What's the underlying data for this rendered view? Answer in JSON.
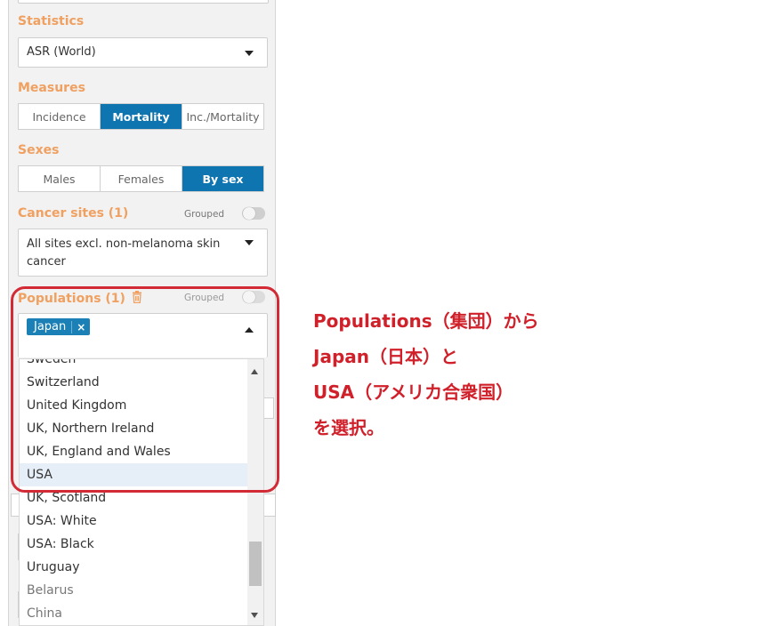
{
  "statistics": {
    "label": "Statistics",
    "value": "ASR (World)"
  },
  "measures": {
    "label": "Measures",
    "options": [
      "Incidence",
      "Mortality",
      "Inc./Mortality"
    ],
    "active": "Mortality"
  },
  "sexes": {
    "label": "Sexes",
    "options": [
      "Males",
      "Females",
      "By sex"
    ],
    "active": "By sex"
  },
  "cancer_sites": {
    "label": "Cancer sites (1)",
    "grouped_label": "Grouped",
    "value_line1": "All sites excl. non-melanoma skin",
    "value_line2": "cancer"
  },
  "populations": {
    "label": "Populations (1)",
    "delete_icon": "trash-icon",
    "grouped_label": "Grouped",
    "selected_tag": "Japan",
    "tag_remove": "×",
    "dropdown_options": [
      "Sweden",
      "Switzerland",
      "United Kingdom",
      "UK, Northern Ireland",
      "UK, England and Wales",
      "USA",
      "UK, Scotland",
      "USA: White",
      "USA: Black",
      "Uruguay",
      "Belarus",
      "China"
    ],
    "highlighted_option": "USA"
  },
  "annotation": {
    "line1": "Populations（集団）から",
    "line2": "Japan（日本）と",
    "line3": "USA（アメリカ合衆国）",
    "line4": "を選択。"
  },
  "colors": {
    "accent": "#0f75b0",
    "section_label": "#f0a060",
    "annotation": "#d0202a"
  }
}
